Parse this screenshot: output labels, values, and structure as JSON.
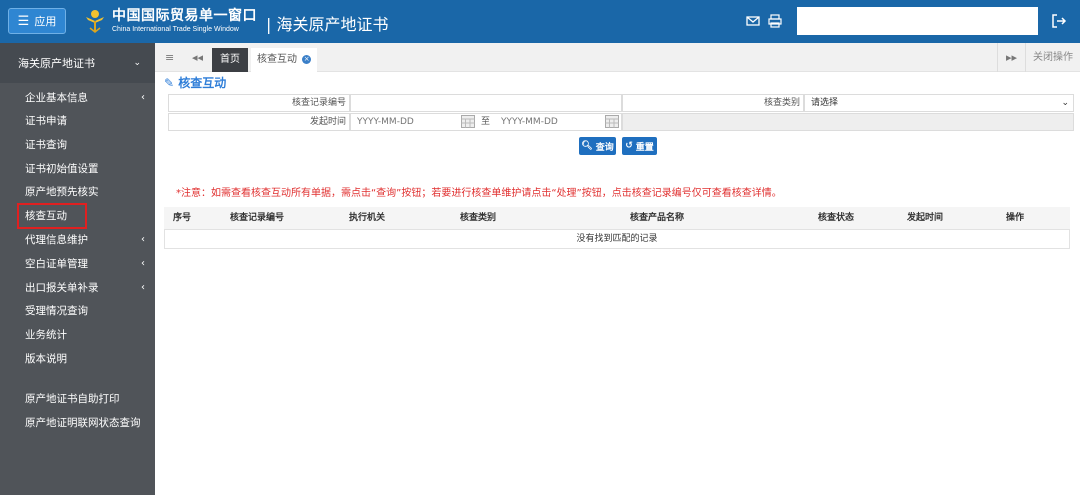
{
  "header": {
    "app_button_label": "应用",
    "logo_cn": "中国国际贸易单一窗口",
    "logo_en": "China International Trade Single Window",
    "system_title": "| 海关原产地证书",
    "search_value": ""
  },
  "sidebar": {
    "title": "海关原产地证书",
    "items": [
      {
        "label": "企业基本信息",
        "caret": true
      },
      {
        "label": "证书申请",
        "caret": false
      },
      {
        "label": "证书查询",
        "caret": false
      },
      {
        "label": "证书初始值设置",
        "caret": false
      },
      {
        "label": "原产地预先核实",
        "caret": false
      },
      {
        "label": "核查互动",
        "caret": false
      },
      {
        "label": "代理信息维护",
        "caret": true
      },
      {
        "label": "空白证单管理",
        "caret": true
      },
      {
        "label": "出口报关单补录",
        "caret": true
      },
      {
        "label": "受理情况查询",
        "caret": false
      },
      {
        "label": "业务统计",
        "caret": false
      },
      {
        "label": "版本说明",
        "caret": false
      },
      {
        "label": "原产地证书自助打印",
        "caret": false
      },
      {
        "label": "原产地证明联网状态查询",
        "caret": false
      }
    ]
  },
  "tabs": {
    "home": "首页",
    "active": "核查互动",
    "close_ops": "关闭操作"
  },
  "page": {
    "title": "核查互动",
    "form": {
      "record_no_label": "核查记录编号",
      "record_no_value": "",
      "category_label": "核查类别",
      "category_value": "请选择",
      "start_time_label": "发起时间",
      "date_from_placeholder": "YYYY-MM-DD",
      "to_label": "至",
      "date_to_placeholder": "YYYY-MM-DD"
    },
    "buttons": {
      "query": "查询",
      "reset": "重置"
    },
    "note": "*注意：如需查看核查互动所有单据，需点击“查询”按钮；若要进行核查单维护请点击“处理”按钮，点击核查记录编号仅可查看核查详情。",
    "table": {
      "columns": [
        "序号",
        "核查记录编号",
        "执行机关",
        "核查类别",
        "核查产品名称",
        "核查状态",
        "发起时间",
        "操作"
      ],
      "empty_text": "没有找到匹配的记录"
    }
  },
  "colors": {
    "header_bg": "#1a67a8",
    "sidebar_bg": "#505459",
    "accent": "#2f7ed8",
    "note_red": "#e03030"
  }
}
